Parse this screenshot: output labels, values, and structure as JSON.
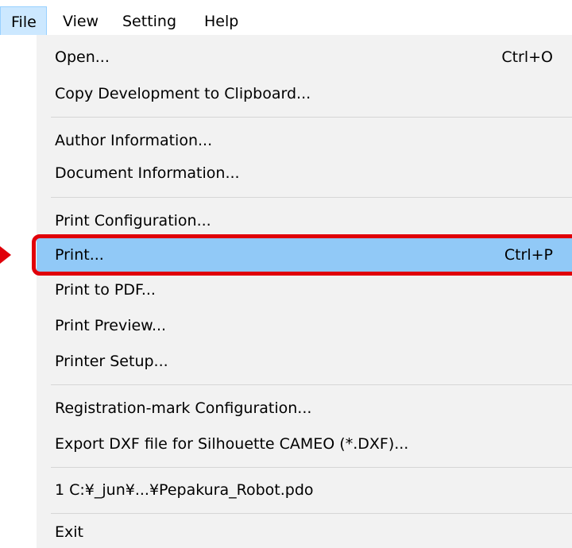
{
  "menubar": {
    "file": "File",
    "view": "View",
    "setting": "Setting",
    "help": "Help"
  },
  "file_menu": {
    "open": {
      "label": "Open...",
      "shortcut": "Ctrl+O"
    },
    "copy_development": {
      "label": "Copy Development to Clipboard..."
    },
    "author_information": {
      "label": "Author Information..."
    },
    "document_information": {
      "label": "Document Information..."
    },
    "print_configuration": {
      "label": "Print Configuration..."
    },
    "print": {
      "label": "Print...",
      "shortcut": "Ctrl+P",
      "highlighted": true
    },
    "print_to_pdf": {
      "label": "Print to PDF..."
    },
    "print_preview": {
      "label": "Print Preview..."
    },
    "printer_setup": {
      "label": "Printer Setup..."
    },
    "registration_mark": {
      "label": "Registration-mark Configuration..."
    },
    "export_dxf": {
      "label": "Export DXF file for Silhouette CAMEO (*.DXF)..."
    },
    "recent_file_1": {
      "label": "1 C:¥_jun¥...¥Pepakura_Robot.pdo"
    },
    "exit": {
      "label": "Exit"
    }
  },
  "colors": {
    "highlight": "#91c9f7",
    "menu_background": "#f2f2f2",
    "callout": "#e0000a"
  }
}
